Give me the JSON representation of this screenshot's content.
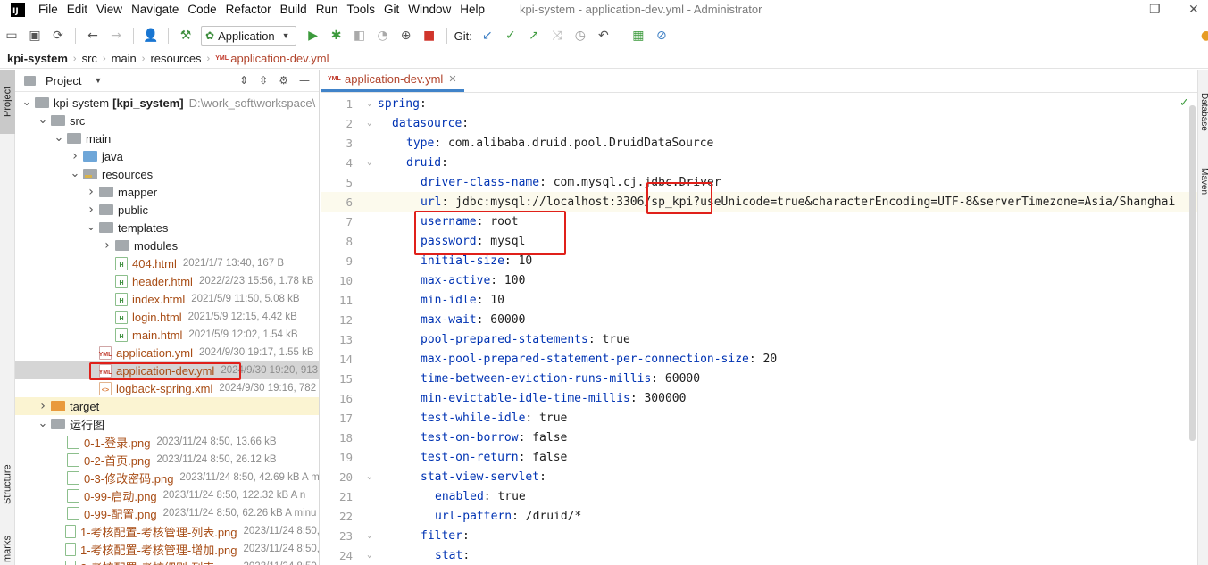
{
  "menu": {
    "items": [
      "File",
      "Edit",
      "View",
      "Navigate",
      "Code",
      "Refactor",
      "Build",
      "Run",
      "Tools",
      "Git",
      "Window",
      "Help"
    ],
    "window_title": "kpi-system - application-dev.yml - Administrator",
    "logo_text": "IJ"
  },
  "toolbar": {
    "run_config": "Application",
    "git_label": "Git:"
  },
  "breadcrumb": [
    "kpi-system",
    "src",
    "main",
    "resources",
    "application-dev.yml"
  ],
  "left_strip": {
    "project": "Project",
    "structure": "Structure",
    "bookmarks": "marks"
  },
  "right_strip": {
    "database": "Database",
    "maven": "Maven"
  },
  "project_panel": {
    "title": "Project",
    "tree": [
      {
        "level": 0,
        "arrow": "down",
        "icon": "folder",
        "label": "kpi-system",
        "bold_suffix": "[kpi_system]",
        "path": "D:\\work_soft\\workspace\\"
      },
      {
        "level": 1,
        "arrow": "down",
        "icon": "folder",
        "label": "src"
      },
      {
        "level": 2,
        "arrow": "down",
        "icon": "folder",
        "label": "main"
      },
      {
        "level": 3,
        "arrow": "right",
        "icon": "folder-blue",
        "label": "java"
      },
      {
        "level": 3,
        "arrow": "down",
        "icon": "folder-res",
        "label": "resources"
      },
      {
        "level": 4,
        "arrow": "right",
        "icon": "folder",
        "label": "mapper"
      },
      {
        "level": 4,
        "arrow": "right",
        "icon": "folder",
        "label": "public"
      },
      {
        "level": 4,
        "arrow": "down",
        "icon": "folder",
        "label": "templates"
      },
      {
        "level": 5,
        "arrow": "right",
        "icon": "folder",
        "label": "modules"
      },
      {
        "level": 5,
        "arrow": "",
        "icon": "html",
        "label": "404.html",
        "meta": "2021/1/7 13:40, 167 B",
        "orange": true
      },
      {
        "level": 5,
        "arrow": "",
        "icon": "html",
        "label": "header.html",
        "meta": "2022/2/23 15:56, 1.78 kB",
        "orange": true
      },
      {
        "level": 5,
        "arrow": "",
        "icon": "html",
        "label": "index.html",
        "meta": "2021/5/9 11:50, 5.08 kB",
        "orange": true
      },
      {
        "level": 5,
        "arrow": "",
        "icon": "html",
        "label": "login.html",
        "meta": "2021/5/9 12:15, 4.42 kB",
        "orange": true
      },
      {
        "level": 5,
        "arrow": "",
        "icon": "html",
        "label": "main.html",
        "meta": "2021/5/9 12:02, 1.54 kB",
        "orange": true
      },
      {
        "level": 4,
        "arrow": "",
        "icon": "yml",
        "label": "application.yml",
        "meta": "2024/9/30 19:17, 1.55 kB",
        "orange": true
      },
      {
        "level": 4,
        "arrow": "",
        "icon": "yml",
        "label": "application-dev.yml",
        "meta": "2024/9/30 19:20, 913",
        "orange": true,
        "selected": true
      },
      {
        "level": 4,
        "arrow": "",
        "icon": "xml",
        "label": "logback-spring.xml",
        "meta": "2024/9/30 19:16, 782",
        "orange": true
      },
      {
        "level": 1,
        "arrow": "right",
        "icon": "folder-orange",
        "label": "target",
        "target": true
      },
      {
        "level": 1,
        "arrow": "down",
        "icon": "folder",
        "label": "运行图"
      },
      {
        "level": 2,
        "arrow": "",
        "icon": "png",
        "label": "0-1-登录.png",
        "meta": "2023/11/24 8:50, 13.66 kB",
        "orange": true
      },
      {
        "level": 2,
        "arrow": "",
        "icon": "png",
        "label": "0-2-首页.png",
        "meta": "2023/11/24 8:50, 26.12 kB",
        "orange": true
      },
      {
        "level": 2,
        "arrow": "",
        "icon": "png",
        "label": "0-3-修改密码.png",
        "meta": "2023/11/24 8:50, 42.69 kB A m",
        "orange": true
      },
      {
        "level": 2,
        "arrow": "",
        "icon": "png",
        "label": "0-99-启动.png",
        "meta": "2023/11/24 8:50, 122.32 kB A n",
        "orange": true
      },
      {
        "level": 2,
        "arrow": "",
        "icon": "png",
        "label": "0-99-配置.png",
        "meta": "2023/11/24 8:50, 62.26 kB A minu",
        "orange": true
      },
      {
        "level": 2,
        "arrow": "",
        "icon": "png",
        "label": "1-考核配置-考核管理-列表.png",
        "meta": "2023/11/24 8:50,",
        "orange": true
      },
      {
        "level": 2,
        "arrow": "",
        "icon": "png",
        "label": "1-考核配置-考核管理-增加.png",
        "meta": "2023/11/24 8:50,",
        "orange": true
      },
      {
        "level": 2,
        "arrow": "",
        "icon": "png",
        "label": "2-考核配置-考核细则-列表.png",
        "meta": "2023/11/24 8:50,",
        "orange": true
      }
    ]
  },
  "editor": {
    "tab_label": "application-dev.yml",
    "lines": [
      {
        "n": 1,
        "indent": 0,
        "key": "spring",
        "val": ""
      },
      {
        "n": 2,
        "indent": 1,
        "key": "datasource",
        "val": ""
      },
      {
        "n": 3,
        "indent": 2,
        "key": "type",
        "val": " com.alibaba.druid.pool.DruidDataSource"
      },
      {
        "n": 4,
        "indent": 2,
        "key": "druid",
        "val": ""
      },
      {
        "n": 5,
        "indent": 3,
        "key": "driver-class-name",
        "val": " com.mysql.cj.jdbc.Driver"
      },
      {
        "n": 6,
        "indent": 3,
        "key": "url",
        "val": " jdbc:mysql://localhost:3306/sp_kpi?useUnicode=true&characterEncoding=UTF-8&serverTimezone=Asia/Shanghai",
        "current": true
      },
      {
        "n": 7,
        "indent": 3,
        "key": "username",
        "val": " root"
      },
      {
        "n": 8,
        "indent": 3,
        "key": "password",
        "val": " mysql"
      },
      {
        "n": 9,
        "indent": 3,
        "key": "initial-size",
        "val": " 10"
      },
      {
        "n": 10,
        "indent": 3,
        "key": "max-active",
        "val": " 100"
      },
      {
        "n": 11,
        "indent": 3,
        "key": "min-idle",
        "val": " 10"
      },
      {
        "n": 12,
        "indent": 3,
        "key": "max-wait",
        "val": " 60000"
      },
      {
        "n": 13,
        "indent": 3,
        "key": "pool-prepared-statements",
        "val": " true"
      },
      {
        "n": 14,
        "indent": 3,
        "key": "max-pool-prepared-statement-per-connection-size",
        "val": " 20"
      },
      {
        "n": 15,
        "indent": 3,
        "key": "time-between-eviction-runs-millis",
        "val": " 60000"
      },
      {
        "n": 16,
        "indent": 3,
        "key": "min-evictable-idle-time-millis",
        "val": " 300000"
      },
      {
        "n": 17,
        "indent": 3,
        "key": "test-while-idle",
        "val": " true"
      },
      {
        "n": 18,
        "indent": 3,
        "key": "test-on-borrow",
        "val": " false"
      },
      {
        "n": 19,
        "indent": 3,
        "key": "test-on-return",
        "val": " false"
      },
      {
        "n": 20,
        "indent": 3,
        "key": "stat-view-servlet",
        "val": ""
      },
      {
        "n": 21,
        "indent": 4,
        "key": "enabled",
        "val": " true"
      },
      {
        "n": 22,
        "indent": 4,
        "key": "url-pattern",
        "val": " /druid/*"
      },
      {
        "n": 23,
        "indent": 3,
        "key": "filter",
        "val": ""
      },
      {
        "n": 24,
        "indent": 4,
        "key": "stat",
        "val": ""
      }
    ]
  },
  "colors": {
    "annotation_box": "#e0201a",
    "yaml_key": "#0033b3",
    "file_name": "#a84d16"
  }
}
